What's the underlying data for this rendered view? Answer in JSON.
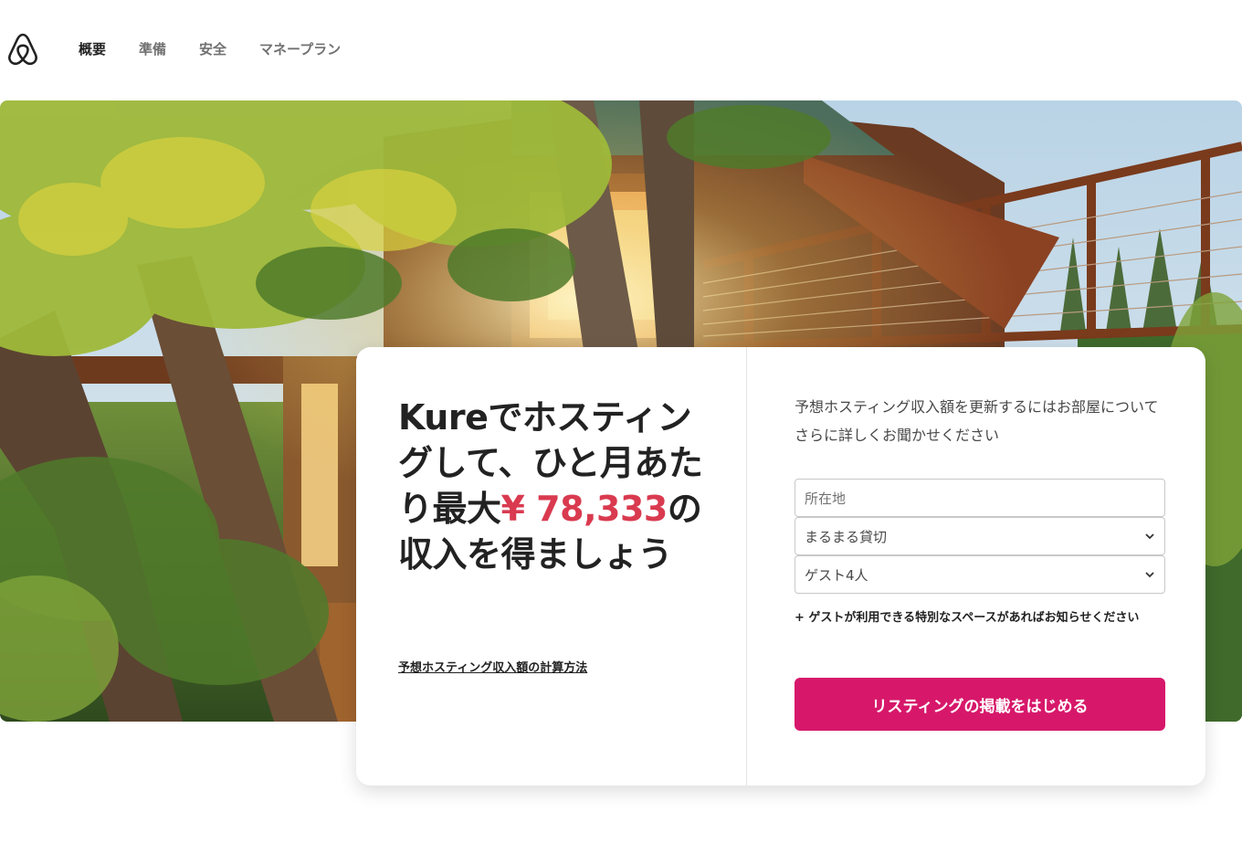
{
  "header": {
    "nav": [
      {
        "label": "概要",
        "active": true
      },
      {
        "label": "準備",
        "active": false
      },
      {
        "label": "安全",
        "active": false
      },
      {
        "label": "マネープラン",
        "active": false
      }
    ]
  },
  "hero": {
    "headline_prefix": "Kureでホスティングして、ひと月あたり最大",
    "amount": "¥ 78,333",
    "headline_suffix": "の収入を得ましょう",
    "calc_link": "予想ホスティング収入額の計算方法"
  },
  "form": {
    "intro": "予想ホスティング収入額を更新するにはお部屋についてさらに詳しくお聞かせください",
    "location_placeholder": "所在地",
    "room_type": "まるまる貸切",
    "guests": "ゲスト4人",
    "add_note": "+ ゲストが利用できる特別なスペースがあればお知らせください",
    "cta": "リスティングの掲載をはじめる"
  },
  "colors": {
    "brand": "#d7186a",
    "amount": "#d93a4f",
    "text": "#222222"
  },
  "icons": {
    "logo": "airbnb-logo-icon",
    "select": "chevron-down-icon"
  }
}
